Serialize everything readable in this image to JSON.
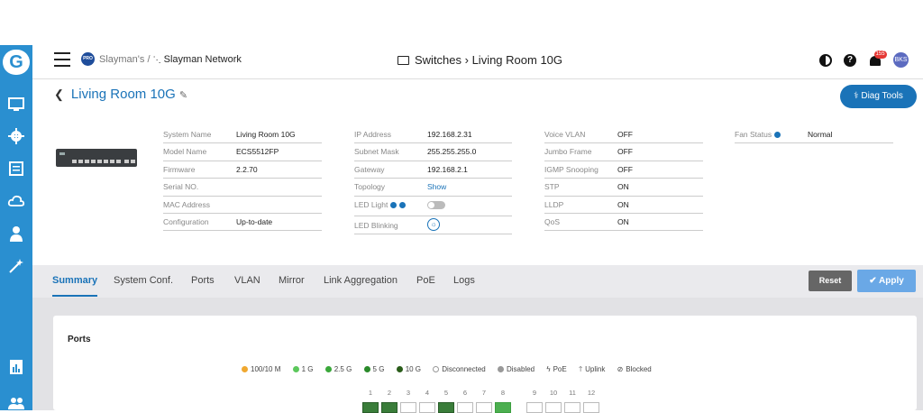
{
  "sidebar": {
    "logo": "G",
    "items": [
      {
        "icon": "monitor-icon"
      },
      {
        "icon": "gear-icon"
      },
      {
        "icon": "document-icon"
      },
      {
        "icon": "cloud-icon"
      },
      {
        "icon": "user-icon"
      },
      {
        "icon": "magic-wand-icon"
      },
      {
        "icon": "report-icon"
      },
      {
        "icon": "users-icon"
      }
    ]
  },
  "topbar": {
    "pro_badge": "PRO",
    "org": "Slayman's",
    "separator": "/",
    "network": "Slayman Network",
    "center_title": "Switches › Living Room 10G",
    "notification_count": "155",
    "avatar": "BKS"
  },
  "page": {
    "title": "Living Room 10G",
    "diag_tools": "Diag Tools"
  },
  "info": {
    "col1": [
      {
        "k": "System Name",
        "v": "Living Room 10G"
      },
      {
        "k": "Model Name",
        "v": "ECS5512FP"
      },
      {
        "k": "Firmware",
        "v": "2.2.70"
      },
      {
        "k": "Serial NO.",
        "v": ""
      },
      {
        "k": "MAC Address",
        "v": ""
      },
      {
        "k": "Configuration",
        "v": "Up-to-date"
      }
    ],
    "col2": [
      {
        "k": "IP Address",
        "v": "192.168.2.31"
      },
      {
        "k": "Subnet Mask",
        "v": "255.255.255.0"
      },
      {
        "k": "Gateway",
        "v": "192.168.2.1"
      },
      {
        "k": "Topology",
        "v": "Show"
      },
      {
        "k": "LED Light",
        "v": ""
      },
      {
        "k": "LED Blinking",
        "v": ""
      }
    ],
    "col3": [
      {
        "k": "Voice VLAN",
        "v": "OFF"
      },
      {
        "k": "Jumbo Frame",
        "v": "OFF"
      },
      {
        "k": "IGMP Snooping",
        "v": "OFF"
      },
      {
        "k": "STP",
        "v": "ON"
      },
      {
        "k": "LLDP",
        "v": "ON"
      },
      {
        "k": "QoS",
        "v": "ON"
      }
    ],
    "col4": [
      {
        "k": "Fan Status",
        "v": "Normal"
      }
    ]
  },
  "tabs": [
    "Summary",
    "System Conf.",
    "Ports",
    "VLAN",
    "Mirror",
    "Link Aggregation",
    "PoE",
    "Logs"
  ],
  "actions": {
    "reset": "Reset",
    "apply": "Apply"
  },
  "ports_card": {
    "title": "Ports",
    "legend": [
      {
        "label": "100/10 M",
        "color": "#f0a830"
      },
      {
        "label": "1 G",
        "color": "#5cc85c"
      },
      {
        "label": "2.5 G",
        "color": "#3aa83a"
      },
      {
        "label": "5 G",
        "color": "#2a8a2a"
      },
      {
        "label": "10 G",
        "color": "#2a5d1a"
      },
      {
        "label": "Disconnected",
        "color": ""
      },
      {
        "label": "Disabled",
        "color": "#999999"
      },
      {
        "label": "PoE",
        "color": ""
      },
      {
        "label": "Uplink",
        "color": ""
      },
      {
        "label": "Blocked",
        "color": ""
      }
    ],
    "port_numbers": [
      "1",
      "2",
      "3",
      "4",
      "5",
      "6",
      "7",
      "8",
      "9",
      "10",
      "11",
      "12"
    ]
  }
}
